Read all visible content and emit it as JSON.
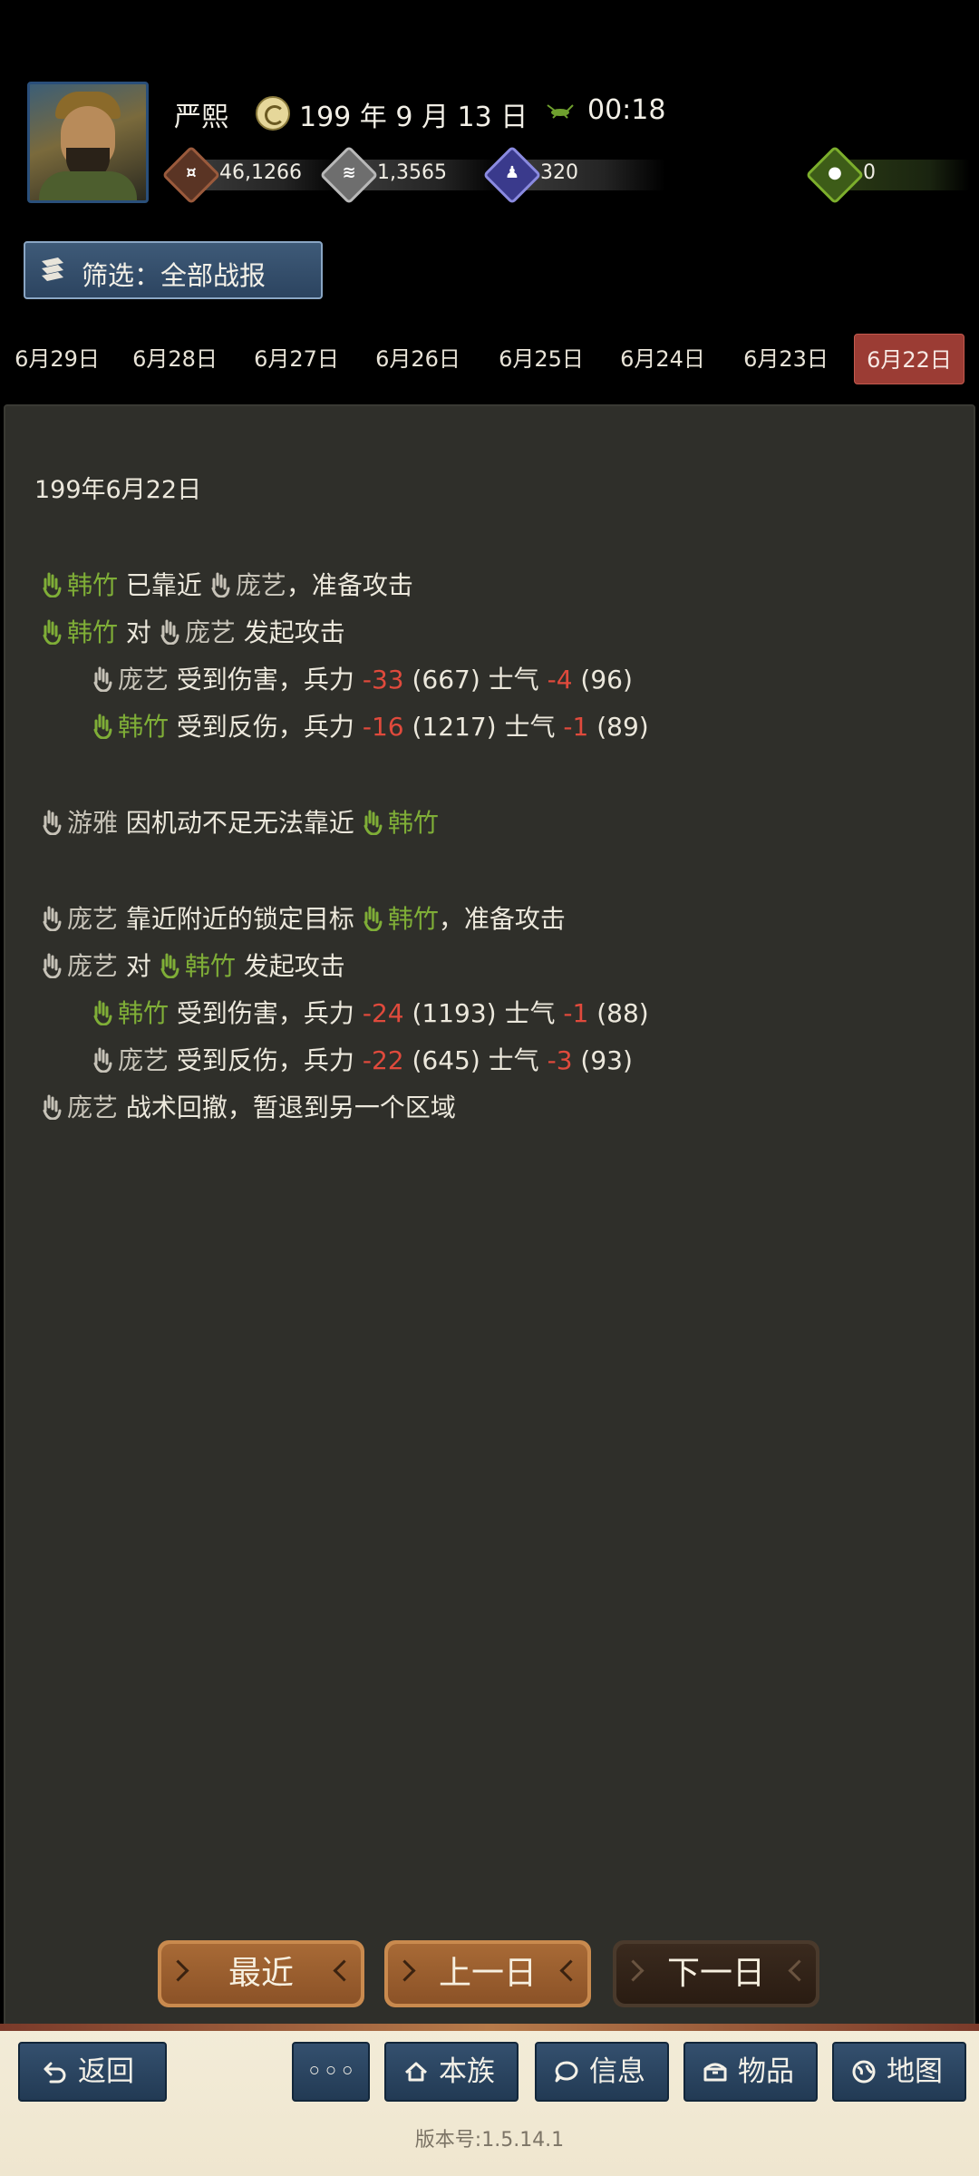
{
  "header": {
    "player_name": "严熙",
    "date": "199 年 9 月 13 日",
    "time": "00:18",
    "resources": {
      "gold": "46,1266",
      "food": "1,3565",
      "troops": "320",
      "special": "0"
    },
    "filter_label": "筛选：全部战报"
  },
  "date_tabs": [
    "6月29日",
    "6月28日",
    "6月27日",
    "6月26日",
    "6月25日",
    "6月24日",
    "6月23日",
    "6月22日"
  ],
  "active_date_tab": "6月22日",
  "log": {
    "date": "199年6月22日",
    "lines": [
      {
        "a": "韩竹",
        "b": "已靠近",
        "c": "庞艺",
        "d": "，准备攻击"
      },
      {
        "a": "韩竹",
        "b": "对",
        "c": "庞艺",
        "d": "发起攻击"
      },
      {
        "a": "庞艺",
        "b": "受到伤害，兵力",
        "c": "-33",
        "d": "(667) 士气",
        "e": "-4",
        "f": "(96)"
      },
      {
        "a": "韩竹",
        "b": "受到反伤，兵力",
        "c": "-16",
        "d": "(1217) 士气",
        "e": "-1",
        "f": "(89)"
      },
      {
        "a": "游雅",
        "b": "因机动不足无法靠近",
        "c": "韩竹"
      },
      {
        "a": "庞艺",
        "b": "靠近附近的锁定目标",
        "c": "韩竹",
        "d": "，准备攻击"
      },
      {
        "a": "庞艺",
        "b": "对",
        "c": "韩竹",
        "d": "发起攻击"
      },
      {
        "a": "韩竹",
        "b": "受到伤害，兵力",
        "c": "-24",
        "d": "(1193) 士气",
        "e": "-1",
        "f": "(88)"
      },
      {
        "a": "庞艺",
        "b": "受到反伤，兵力",
        "c": "-22",
        "d": "(645) 士气",
        "e": "-3",
        "f": "(93)"
      },
      {
        "a": "庞艺",
        "b": "战术回撤，暂退到另一个区域"
      }
    ]
  },
  "day_nav": {
    "recent": "最近",
    "prev": "上一日",
    "next": "下一日"
  },
  "bottom_nav": {
    "back": "返回",
    "more": "◦◦◦",
    "clan": "本族",
    "info": "信息",
    "items": "物品",
    "map": "地图"
  },
  "version": "版本号:1.5.14.1",
  "colors": {
    "ally_green": "#7fae37",
    "loss_red": "#e04a3c",
    "active_tab": "#9b3c34",
    "panel_bg": "#2f2f2a"
  },
  "icons": {
    "unit_marker": "hand-icon",
    "date": "calendar-coin-icon",
    "time": "cricket-icon",
    "filter": "scroll-icon"
  }
}
